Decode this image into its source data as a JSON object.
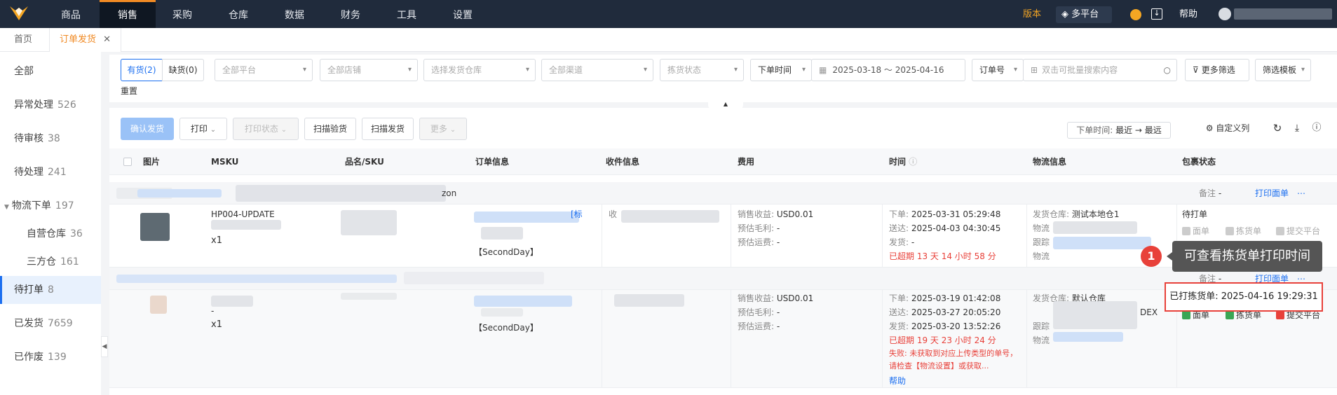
{
  "topnav": {
    "items": [
      "商品",
      "销售",
      "采购",
      "仓库",
      "数据",
      "财务",
      "工具",
      "设置"
    ],
    "version_label": "版本",
    "platform_label": "多平台",
    "help_label": "帮助"
  },
  "subtabs": {
    "home": "首页",
    "current": "订单发货"
  },
  "sidebar": {
    "items": [
      {
        "label": "全部",
        "count": ""
      },
      {
        "label": "异常处理",
        "count": "526"
      },
      {
        "label": "待审核",
        "count": "38"
      },
      {
        "label": "待处理",
        "count": "241"
      },
      {
        "label": "物流下单",
        "count": "197"
      },
      {
        "label": "自营仓库",
        "count": "36"
      },
      {
        "label": "三方仓",
        "count": "161"
      },
      {
        "label": "待打单",
        "count": "8"
      },
      {
        "label": "已发货",
        "count": "7659"
      },
      {
        "label": "已作废",
        "count": "139"
      }
    ]
  },
  "filters": {
    "in_stock": "有货(2)",
    "out_stock": "缺货(0)",
    "platform": "全部平台",
    "store": "全部店铺",
    "warehouse": "选择发货仓库",
    "channel": "全部渠道",
    "pick_status": "拣货状态",
    "time_type": "下单时间",
    "date_range": "2025-03-18  ～  2025-04-16",
    "order_no": "订单号",
    "search_placeholder": "双击可批量搜索内容",
    "more_filters": "更多筛选",
    "filter_template": "筛选模板",
    "reset": "重置"
  },
  "toolbar": {
    "confirm": "确认发货",
    "print": "打印",
    "print_status": "打印状态",
    "scan_check": "扫描验货",
    "scan_ship": "扫描发货",
    "more": "更多",
    "sort_label": "下单时间:",
    "sort_value": "最近 → 最远",
    "custom_cols": "自定义列"
  },
  "columns": [
    "图片",
    "MSKU",
    "品名/SKU",
    "订单信息",
    "收件信息",
    "费用",
    "时间",
    "物流信息",
    "包裹状态"
  ],
  "group1": {
    "store_suffix": "zon",
    "note_label": "备注",
    "note_value": "-",
    "print_sheet": "打印面单"
  },
  "group2": {
    "note_label": "备注",
    "note_value": "-",
    "print_sheet": "打印面单"
  },
  "order1": {
    "msku": "HP004-UPDATE",
    "qty": "x1",
    "tag": "[标",
    "shipping_level": "【SecondDay】",
    "recv_prefix": "收",
    "fee_rev_label": "销售收益:",
    "fee_rev": "USD0.01",
    "fee_margin_label": "预估毛利:",
    "fee_margin": "-",
    "fee_ship_label": "预估运费:",
    "fee_ship": "-",
    "t_order_label": "下单:",
    "t_order": "2025-03-31 05:29:48",
    "t_deliver_label": "送达:",
    "t_deliver": "2025-04-03 04:30:45",
    "t_ship_label": "发货:",
    "t_ship": "-",
    "overdue": "已超期 13 天 14 小时 58 分",
    "wh_label": "发货仓库:",
    "wh": "测试本地仓1",
    "log_lines": [
      "物流",
      "跟踪",
      "物流"
    ],
    "status": "待打单",
    "act_sheet": "面单",
    "act_pick": "拣货单",
    "act_submit": "提交平台"
  },
  "order2": {
    "qty": "x1",
    "dash": "-",
    "shipping_level": "【SecondDay】",
    "fee_rev_label": "销售收益:",
    "fee_rev": "USD0.01",
    "fee_margin_label": "预估毛利:",
    "fee_margin": "-",
    "fee_ship_label": "预估运费:",
    "fee_ship": "-",
    "t_order_label": "下单:",
    "t_order": "2025-03-19 01:42:08",
    "t_deliver_label": "送达:",
    "t_deliver": "2025-03-27 20:05:20",
    "t_ship_label": "发货:",
    "t_ship": "2025-03-20 13:52:26",
    "overdue": "已超期 19 天 23 小时 24 分",
    "fail": "失败: 未获取到对应上传类型的单号，请检查【物流设置】或获取...",
    "help": "帮助",
    "wh_label": "发货仓库:",
    "wh": "默认仓库",
    "carrier": "DEX",
    "log_lines": [
      "跟踪",
      "物流"
    ],
    "act_sheet": "面单",
    "act_pick": "拣货单",
    "act_submit": "提交平台"
  },
  "tooltip": {
    "badge": "1",
    "text": "可查看拣货单打印时间"
  },
  "printed": {
    "text": "已打拣货单: 2025-04-16 19:29:31"
  },
  "colors": {
    "accent": "#f08a24",
    "primary": "#1c6ff0",
    "danger": "#e8413a",
    "nav_bg": "#202b3c"
  }
}
